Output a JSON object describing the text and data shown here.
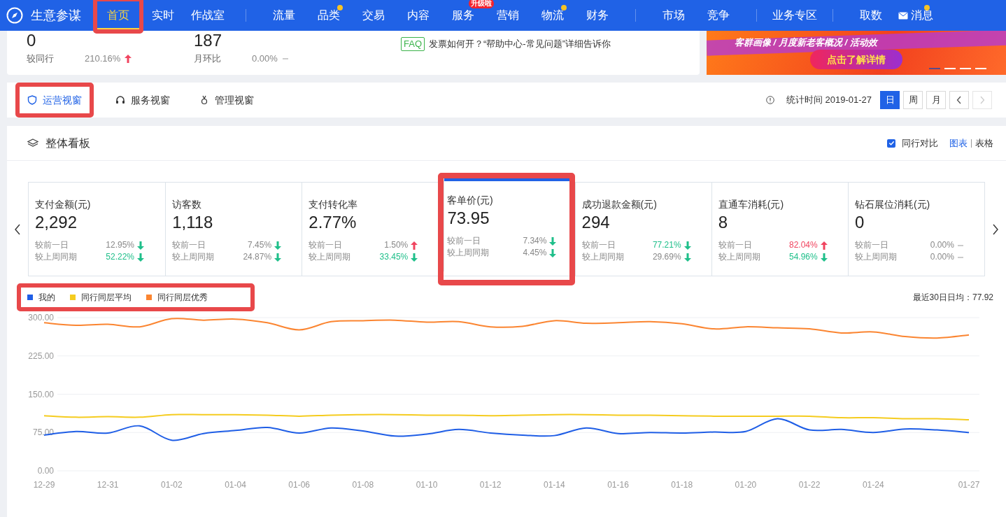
{
  "nav": {
    "brand": "生意参谋",
    "groups": [
      [
        {
          "label": "首页",
          "selected": true,
          "dot": false,
          "highlighted": true
        },
        {
          "label": "实时",
          "selected": false,
          "dot": false,
          "highlighted": false
        },
        {
          "label": "作战室",
          "selected": false,
          "dot": false,
          "highlighted": false
        }
      ],
      [
        {
          "label": "流量",
          "selected": false,
          "dot": false,
          "highlighted": false
        },
        {
          "label": "品类",
          "selected": false,
          "dot": true,
          "highlighted": false
        },
        {
          "label": "交易",
          "selected": false,
          "dot": false,
          "highlighted": false
        },
        {
          "label": "内容",
          "selected": false,
          "dot": false,
          "highlighted": false
        },
        {
          "label": "服务",
          "selected": false,
          "dot": false,
          "badge": "升级啦",
          "highlighted": false
        },
        {
          "label": "营销",
          "selected": false,
          "dot": false,
          "highlighted": false
        },
        {
          "label": "物流",
          "selected": false,
          "dot": true,
          "highlighted": false
        },
        {
          "label": "财务",
          "selected": false,
          "dot": false,
          "highlighted": false
        }
      ],
      [
        {
          "label": "市场",
          "selected": false,
          "dot": false,
          "highlighted": false
        },
        {
          "label": "竞争",
          "selected": false,
          "dot": false,
          "highlighted": false
        }
      ],
      [
        {
          "label": "业务专区",
          "selected": false,
          "dot": false,
          "highlighted": false
        }
      ],
      [
        {
          "label": "取数",
          "selected": false,
          "dot": false,
          "highlighted": false,
          "kind": "text"
        },
        {
          "label": "消息",
          "selected": false,
          "dot": true,
          "highlighted": false,
          "kind": "mail"
        }
      ]
    ]
  },
  "summary": {
    "stats": [
      {
        "value": "0",
        "compare_label": "较同行",
        "compare_value": "210.16%",
        "kind": "up"
      },
      {
        "value": "187",
        "compare_label": "月环比",
        "compare_value": "0.00%",
        "kind": "flat"
      }
    ],
    "faq": {
      "tag": "FAQ",
      "text": "发票如何开？“帮助中心-常见问题”详细告诉你"
    }
  },
  "banner": {
    "caption": "客群画像 / 月度新老客概况 / 活动效",
    "button": "点击了解详情",
    "slides": [
      {
        "selected": true
      },
      {
        "selected": false
      },
      {
        "selected": false
      },
      {
        "selected": false
      }
    ]
  },
  "view_tabs": [
    {
      "label": "运营视窗",
      "selected": true,
      "highlighted": true
    },
    {
      "label": "服务视窗",
      "selected": false,
      "highlighted": false
    },
    {
      "label": "管理视窗",
      "selected": false,
      "highlighted": false
    }
  ],
  "stat_time": "统计时间 2019-01-27",
  "period_buttons": [
    {
      "label": "日",
      "selected": true
    },
    {
      "label": "周",
      "selected": false
    },
    {
      "label": "月",
      "selected": false
    }
  ],
  "dashboard": {
    "title": "整体看板",
    "peer_compare": {
      "label": "同行对比",
      "checked": true
    },
    "view_modes": [
      {
        "label": "图表",
        "selected": true
      },
      {
        "label": "表格",
        "selected": false
      }
    ],
    "metrics": [
      {
        "label": "支付金额(元)",
        "value": "2,292",
        "selected": false,
        "highlighted": false,
        "rows": [
          {
            "label": "较前一日",
            "value": "12.95%",
            "kind": "down",
            "emphasized": false
          },
          {
            "label": "较上周同期",
            "value": "52.22%",
            "kind": "down",
            "emphasized": true
          }
        ]
      },
      {
        "label": "访客数",
        "value": "1,118",
        "selected": false,
        "highlighted": false,
        "rows": [
          {
            "label": "较前一日",
            "value": "7.45%",
            "kind": "down",
            "emphasized": false
          },
          {
            "label": "较上周同期",
            "value": "24.87%",
            "kind": "down",
            "emphasized": false
          }
        ]
      },
      {
        "label": "支付转化率",
        "value": "2.77%",
        "selected": false,
        "highlighted": false,
        "rows": [
          {
            "label": "较前一日",
            "value": "1.50%",
            "kind": "up",
            "emphasized": false
          },
          {
            "label": "较上周同期",
            "value": "33.45%",
            "kind": "down",
            "emphasized": true
          }
        ]
      },
      {
        "label": "客单价(元)",
        "value": "73.95",
        "selected": true,
        "highlighted": true,
        "rows": [
          {
            "label": "较前一日",
            "value": "7.34%",
            "kind": "down",
            "emphasized": false
          },
          {
            "label": "较上周同期",
            "value": "4.45%",
            "kind": "down",
            "emphasized": false
          }
        ]
      },
      {
        "label": "成功退款金额(元)",
        "value": "294",
        "selected": false,
        "highlighted": false,
        "rows": [
          {
            "label": "较前一日",
            "value": "77.21%",
            "kind": "down",
            "emphasized": true
          },
          {
            "label": "较上周同期",
            "value": "29.69%",
            "kind": "down",
            "emphasized": false
          }
        ]
      },
      {
        "label": "直通车消耗(元)",
        "value": "8",
        "selected": false,
        "highlighted": false,
        "rows": [
          {
            "label": "较前一日",
            "value": "82.04%",
            "kind": "up",
            "emphasized": true
          },
          {
            "label": "较上周同期",
            "value": "54.96%",
            "kind": "down",
            "emphasized": true
          }
        ]
      },
      {
        "label": "钻石展位消耗(元)",
        "value": "0",
        "selected": false,
        "highlighted": false,
        "rows": [
          {
            "label": "较前一日",
            "value": "0.00%",
            "kind": "flat",
            "emphasized": false
          },
          {
            "label": "较上周同期",
            "value": "0.00%",
            "kind": "flat",
            "emphasized": false
          }
        ]
      }
    ],
    "legend_highlighted": true,
    "average": "最近30日日均：77.92",
    "chart_data": {
      "type": "line",
      "grid": true,
      "categories": [
        "12-29",
        null,
        "12-31",
        null,
        "01-02",
        null,
        "01-04",
        null,
        "01-06",
        null,
        "01-08",
        null,
        "01-10",
        null,
        "01-12",
        null,
        "01-14",
        null,
        "01-16",
        null,
        "01-18",
        null,
        "01-20",
        null,
        "01-22",
        null,
        "01-24",
        null,
        null,
        "01-27"
      ],
      "series": [
        {
          "name": "我的",
          "color": "#1f5ee6",
          "values": [
            70,
            77,
            74,
            88,
            60,
            73,
            79,
            85,
            74,
            84,
            78,
            68,
            72,
            81,
            74,
            70,
            69,
            84,
            73,
            75,
            74,
            76,
            77,
            102,
            80,
            81,
            75,
            82,
            80,
            75
          ]
        },
        {
          "name": "同行同层平均",
          "color": "#f5cc1f",
          "values": [
            108,
            105,
            106,
            105,
            110,
            110,
            110,
            109,
            107,
            109,
            110,
            110,
            109,
            109,
            108,
            109,
            110,
            110,
            109,
            109,
            108,
            107,
            107,
            107,
            107,
            104,
            104,
            102,
            102,
            100
          ]
        },
        {
          "name": "同行同层优秀",
          "color": "#fb8531",
          "values": [
            290,
            285,
            287,
            282,
            298,
            295,
            297,
            290,
            276,
            292,
            294,
            295,
            291,
            292,
            282,
            283,
            294,
            289,
            290,
            292,
            288,
            278,
            282,
            280,
            278,
            270,
            272,
            263,
            260,
            266
          ]
        }
      ],
      "ylim": [
        0,
        300
      ],
      "yticks": [
        {
          "value": 0,
          "label": "0.00"
        },
        {
          "value": 75,
          "label": "75.00"
        },
        {
          "value": 150,
          "label": "150.00"
        },
        {
          "value": 225,
          "label": "225.00"
        },
        {
          "value": 300,
          "label": "300.00"
        }
      ]
    }
  }
}
